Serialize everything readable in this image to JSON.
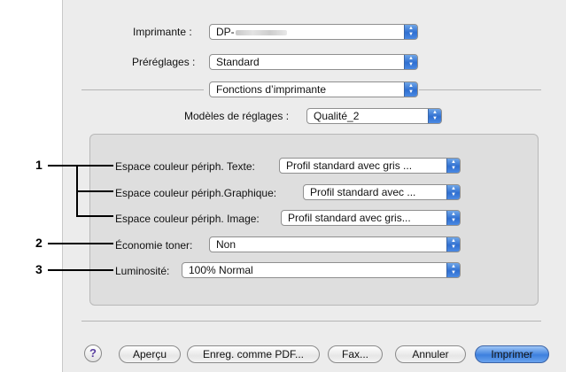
{
  "printer": {
    "label": "Imprimante :",
    "value": "DP-"
  },
  "presets": {
    "label": "Préréglages :",
    "value": "Standard"
  },
  "panel": {
    "value": "Fonctions d’imprimante"
  },
  "setting_templates": {
    "label": "Modèles de réglages :",
    "value": "Qualité_2"
  },
  "options": [
    {
      "label": "Espace couleur périph. Texte:",
      "value": "Profil standard avec gris ..."
    },
    {
      "label": "Espace couleur périph.Graphique:",
      "value": "Profil standard avec ..."
    },
    {
      "label": "Espace couleur périph. Image:",
      "value": "Profil standard avec gris..."
    },
    {
      "label": "Économie toner:",
      "value": "Non"
    },
    {
      "label": "Luminosité:",
      "value": "100% Normal"
    }
  ],
  "callouts": [
    "1",
    "2",
    "3"
  ],
  "buttons": {
    "help": "?",
    "preview": "Aperçu",
    "save_pdf": "Enreg. comme PDF...",
    "fax": "Fax...",
    "cancel": "Annuler",
    "print": "Imprimer"
  },
  "colors": {
    "accent": "#3d80de",
    "dialog_bg": "#ececec",
    "group_bg": "#dedede"
  },
  "icons": {
    "popup": "up-down-arrows-icon"
  }
}
